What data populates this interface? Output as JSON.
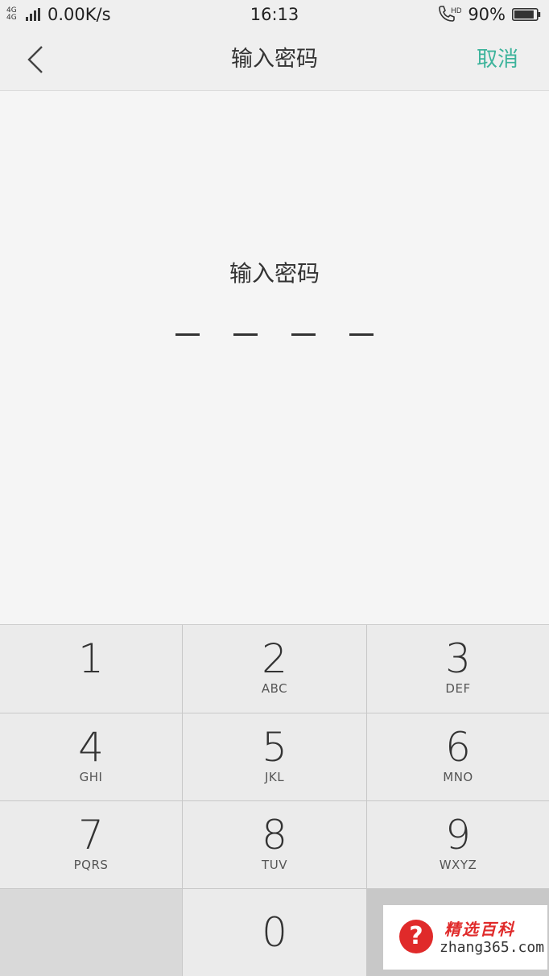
{
  "status_bar": {
    "network": "4G 4G",
    "speed": "0.00K/s",
    "time": "16:13",
    "call_hd": "HD",
    "battery": "90%",
    "battery_level": 0.9
  },
  "nav": {
    "title": "输入密码",
    "cancel": "取消"
  },
  "content": {
    "prompt": "输入密码",
    "pin_length": 4
  },
  "keypad": {
    "keys": [
      {
        "digit": "1",
        "letters": ""
      },
      {
        "digit": "2",
        "letters": "ABC"
      },
      {
        "digit": "3",
        "letters": "DEF"
      },
      {
        "digit": "4",
        "letters": "GHI"
      },
      {
        "digit": "5",
        "letters": "JKL"
      },
      {
        "digit": "6",
        "letters": "MNO"
      },
      {
        "digit": "7",
        "letters": "PQRS"
      },
      {
        "digit": "8",
        "letters": "TUV"
      },
      {
        "digit": "9",
        "letters": "WXYZ"
      },
      {
        "digit": "0",
        "letters": ""
      }
    ]
  },
  "watermark": {
    "title": "精选百科",
    "url": "zhang365.com",
    "icon": "question-mark-icon"
  },
  "colors": {
    "accent": "#3cb39b",
    "watermark_red": "#e02a2a"
  }
}
